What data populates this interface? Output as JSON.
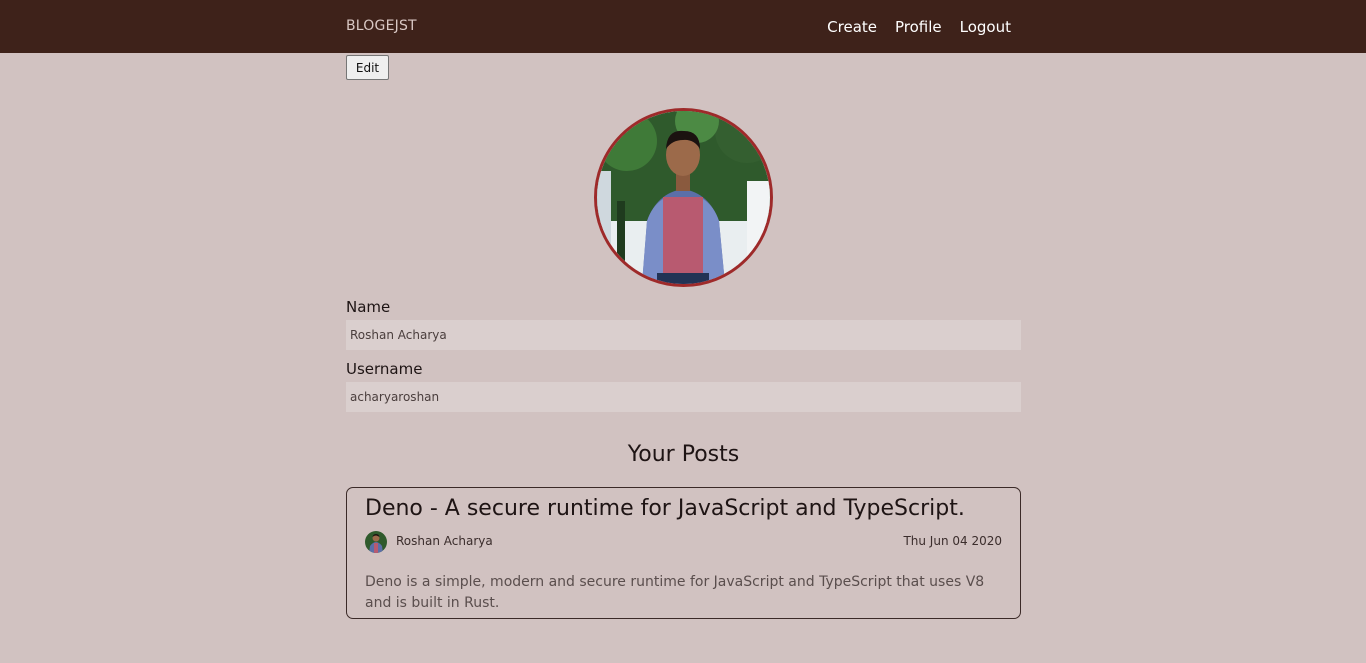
{
  "navbar": {
    "brand": "BLOGEJST",
    "links": [
      "Create",
      "Profile",
      "Logout"
    ],
    "background": "#3e221a"
  },
  "profile": {
    "edit_label": "Edit",
    "name_label": "Name",
    "name_value": "Roshan Acharya",
    "username_label": "Username",
    "username_value": "acharyaroshan",
    "avatar_border": "#9e2a2a"
  },
  "posts": {
    "heading": "Your Posts",
    "items": [
      {
        "title": "Deno - A secure runtime for JavaScript and TypeScript.",
        "author": "Roshan Acharya",
        "date": "Thu Jun 04 2020",
        "excerpt": "Deno is a simple, modern and secure runtime for JavaScript and TypeScript that uses V8 and is built in Rust."
      }
    ]
  },
  "colors": {
    "page_background": "#d1c2c1",
    "input_background": "#dacfce"
  }
}
